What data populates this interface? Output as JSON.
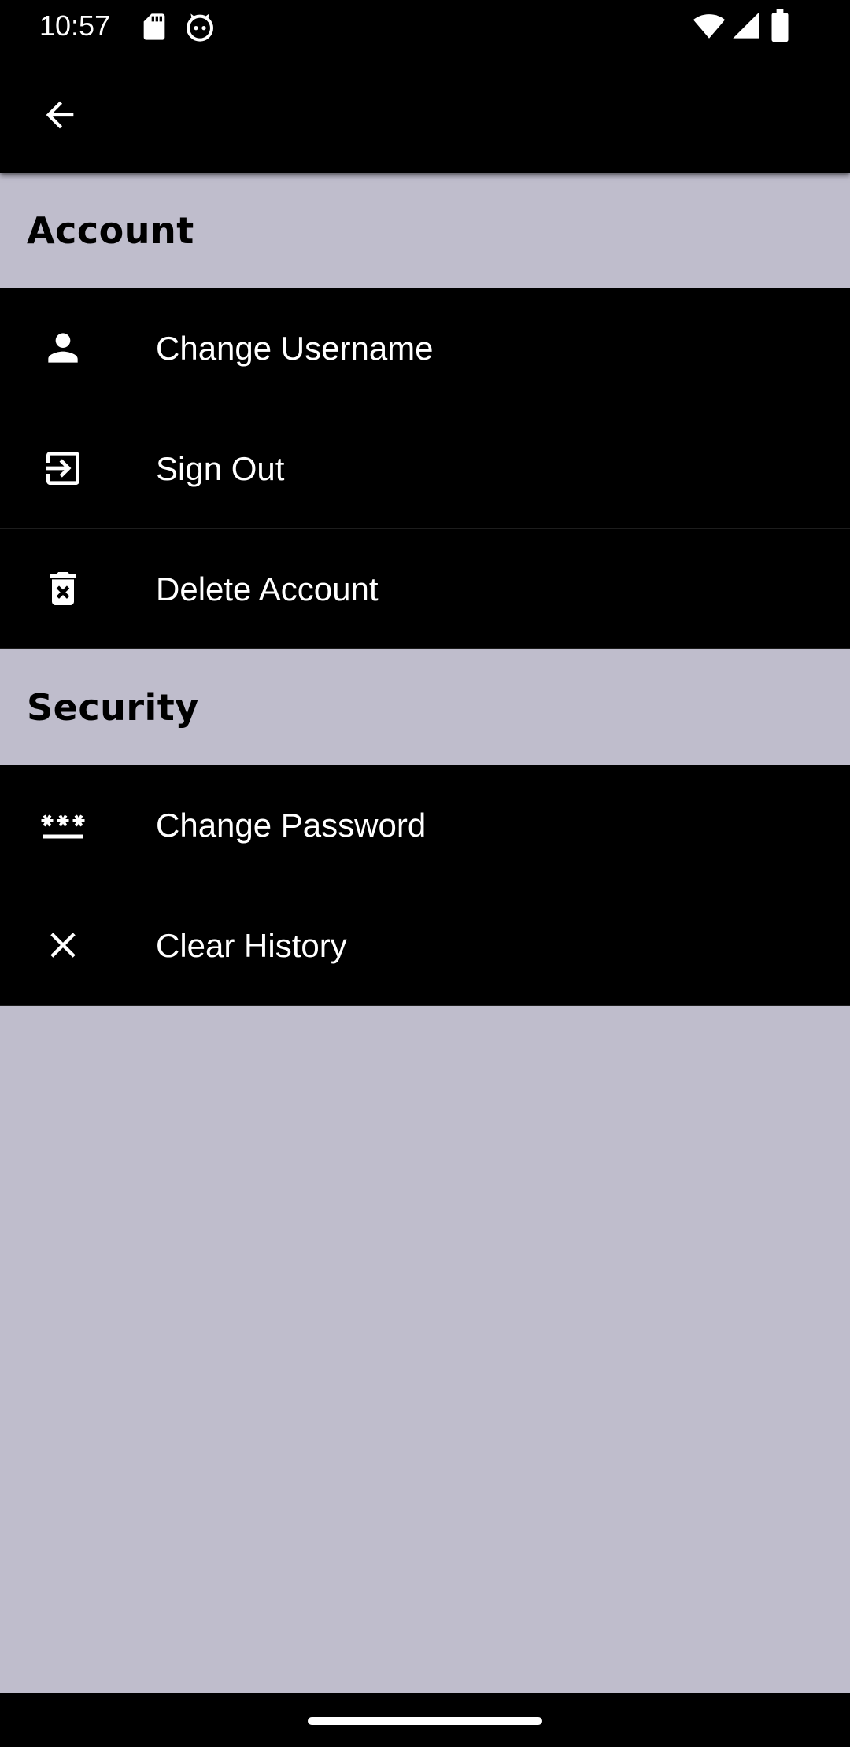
{
  "status_bar": {
    "time": "10:57",
    "left_icons": [
      "sd-card-icon",
      "cat-notification-icon"
    ],
    "right_icons": [
      "wifi-icon",
      "signal-icon",
      "battery-icon"
    ]
  },
  "app_bar": {
    "back_icon": "arrow-back-icon"
  },
  "sections": [
    {
      "title": "Account",
      "items": [
        {
          "label": "Change Username",
          "icon": "person-icon"
        },
        {
          "label": "Sign Out",
          "icon": "exit-icon"
        },
        {
          "label": "Delete Account",
          "icon": "delete-forever-icon"
        }
      ]
    },
    {
      "title": "Security",
      "items": [
        {
          "label": "Change Password",
          "icon": "password-icon"
        },
        {
          "label": "Clear History",
          "icon": "close-icon"
        }
      ]
    }
  ],
  "colors": {
    "background": "#bfbdcc",
    "row_background": "#000000",
    "text_primary": "#ffffff",
    "section_text": "#000000"
  }
}
